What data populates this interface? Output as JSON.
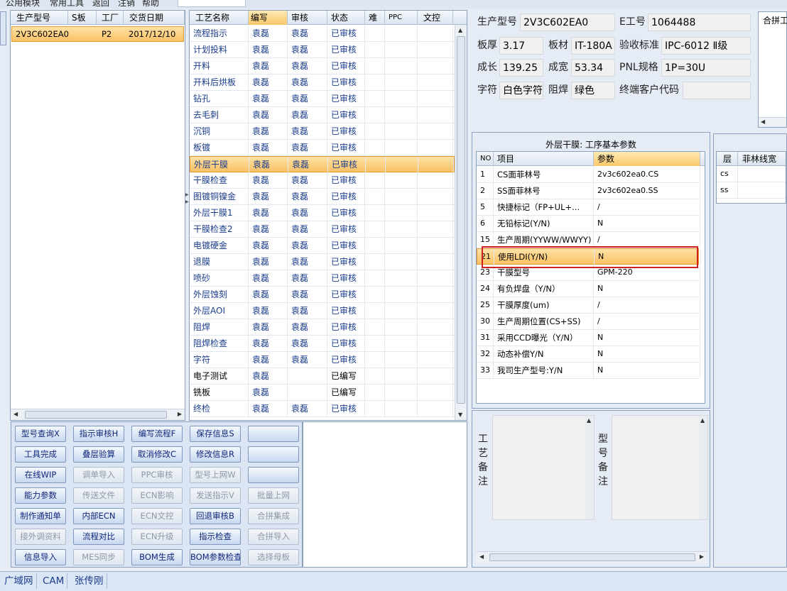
{
  "menu": [
    "公用模块",
    "常用工具",
    "返回",
    "注销",
    "帮助"
  ],
  "model_table": {
    "headers": [
      "生产型号",
      "S板",
      "工厂",
      "交货日期"
    ],
    "rows": [
      [
        "2V3C602EA0",
        "",
        "P2",
        "2017/12/10"
      ]
    ]
  },
  "process_table": {
    "headers": [
      "工艺名称",
      "编写",
      "审核",
      "状态",
      "难",
      "PPC",
      "文控"
    ],
    "rows": [
      [
        "流程指示",
        "袁磊",
        "袁磊",
        "已审核"
      ],
      [
        "计划投料",
        "袁磊",
        "袁磊",
        "已审核"
      ],
      [
        "开料",
        "袁磊",
        "袁磊",
        "已审核"
      ],
      [
        "开料后烘板",
        "袁磊",
        "袁磊",
        "已审核"
      ],
      [
        "钻孔",
        "袁磊",
        "袁磊",
        "已审核"
      ],
      [
        "去毛刺",
        "袁磊",
        "袁磊",
        "已审核"
      ],
      [
        "沉铜",
        "袁磊",
        "袁磊",
        "已审核"
      ],
      [
        "板镀",
        "袁磊",
        "袁磊",
        "已审核"
      ],
      [
        "外层干膜",
        "袁磊",
        "袁磊",
        "已审核"
      ],
      [
        "干膜检查",
        "袁磊",
        "袁磊",
        "已审核"
      ],
      [
        "图镀铜镍金",
        "袁磊",
        "袁磊",
        "已审核"
      ],
      [
        "外层干膜1",
        "袁磊",
        "袁磊",
        "已审核"
      ],
      [
        "干膜检查2",
        "袁磊",
        "袁磊",
        "已审核"
      ],
      [
        "电镀硬金",
        "袁磊",
        "袁磊",
        "已审核"
      ],
      [
        "退膜",
        "袁磊",
        "袁磊",
        "已审核"
      ],
      [
        "喷砂",
        "袁磊",
        "袁磊",
        "已审核"
      ],
      [
        "外层蚀刻",
        "袁磊",
        "袁磊",
        "已审核"
      ],
      [
        "外层AOI",
        "袁磊",
        "袁磊",
        "已审核"
      ],
      [
        "阻焊",
        "袁磊",
        "袁磊",
        "已审核"
      ],
      [
        "阻焊检查",
        "袁磊",
        "袁磊",
        "已审核"
      ],
      [
        "字符",
        "袁磊",
        "袁磊",
        "已审核"
      ],
      [
        "电子测试",
        "袁磊",
        "",
        "已编写"
      ],
      [
        "铣板",
        "袁磊",
        "",
        "已编写"
      ],
      [
        "终检",
        "袁磊",
        "袁磊",
        "已审核"
      ]
    ]
  },
  "buttons": [
    [
      {
        "label": "型号查询X",
        "enabled": true
      },
      {
        "label": "指示审核H",
        "enabled": true
      },
      {
        "label": "编写流程F",
        "enabled": true
      },
      {
        "label": "保存信息S",
        "enabled": true
      },
      {
        "label": "",
        "enabled": true
      }
    ],
    [
      {
        "label": "工具完成",
        "enabled": true
      },
      {
        "label": "叠层验算",
        "enabled": true
      },
      {
        "label": "取消修改C",
        "enabled": true
      },
      {
        "label": "修改信息R",
        "enabled": true
      },
      {
        "label": "",
        "enabled": true
      }
    ],
    [
      {
        "label": "在线WIP",
        "enabled": true
      },
      {
        "label": "调单导入",
        "enabled": false
      },
      {
        "label": "PPC审核",
        "enabled": false
      },
      {
        "label": "型号上网W",
        "enabled": false
      },
      {
        "label": "",
        "enabled": true
      }
    ],
    [
      {
        "label": "能力参数",
        "enabled": true
      },
      {
        "label": "传送文件",
        "enabled": false
      },
      {
        "label": "ECN影响",
        "enabled": false
      },
      {
        "label": "发送指示V",
        "enabled": false
      },
      {
        "label": "批量上网",
        "enabled": false
      }
    ],
    [
      {
        "label": "制作通知单",
        "enabled": true
      },
      {
        "label": "内部ECN",
        "enabled": true
      },
      {
        "label": "ECN文控",
        "enabled": false
      },
      {
        "label": "回退审核B",
        "enabled": true
      },
      {
        "label": "合拼集成",
        "enabled": false
      }
    ],
    [
      {
        "label": "接外调资料",
        "enabled": false
      },
      {
        "label": "流程对比",
        "enabled": true
      },
      {
        "label": "ECN升级",
        "enabled": false
      },
      {
        "label": "指示检查",
        "enabled": true
      },
      {
        "label": "合拼导入",
        "enabled": false
      }
    ],
    [
      {
        "label": "信息导入",
        "enabled": true
      },
      {
        "label": "MES同步",
        "enabled": false
      },
      {
        "label": "BOM生成",
        "enabled": true
      },
      {
        "label": "BOM参数检查",
        "enabled": true
      },
      {
        "label": "选择母板",
        "enabled": false
      }
    ]
  ],
  "info": {
    "model_label": "生产型号",
    "model_value": "2V3C602EA0",
    "eno_label": "E工号",
    "eno_value": "1064488",
    "thick_label": "板厚",
    "thick_value": "3.17",
    "material_label": "板材",
    "material_value": "IT-180A",
    "std_label": "验收标准",
    "std_value": "IPC-6012 Ⅱ级",
    "len_label": "成长",
    "len_value": "139.25",
    "width_label": "成宽",
    "width_value": "53.34",
    "pnl_label": "PNL规格",
    "pnl_value": "1P=30U",
    "char_label": "字符",
    "char_value": "白色字符",
    "mask_label": "阻焊",
    "mask_value": "绿色",
    "cust_label": "终端客户代码",
    "cust_value": ""
  },
  "combine_header": "合拼工",
  "params": {
    "title": "外层干膜: 工序基本参数",
    "headers": [
      "NO",
      "项目",
      "参数"
    ],
    "rows": [
      [
        "1",
        "CS面菲林号",
        "2v3c602ea0.CS"
      ],
      [
        "2",
        "SS面菲林号",
        "2v3c602ea0.SS"
      ],
      [
        "5",
        "快捷标记（FP+UL+...",
        "/"
      ],
      [
        "6",
        "无铅标记(Y/N)",
        "N"
      ],
      [
        "15",
        "生产周期(YYWW/WWYY)",
        "/"
      ],
      [
        "21",
        "使用LDI(Y/N)",
        "N"
      ],
      [
        "23",
        "干膜型号",
        "GPM-220"
      ],
      [
        "24",
        "有负焊盘（Y/N）",
        "N"
      ],
      [
        "25",
        "干膜厚度(um)",
        "/"
      ],
      [
        "30",
        "生产周期位置(CS+SS)",
        "/"
      ],
      [
        "31",
        "采用CCD曝光（Y/N）",
        "N"
      ],
      [
        "32",
        "动态补偿Y/N",
        "N"
      ],
      [
        "33",
        "我司生产型号:Y/N",
        "N"
      ]
    ]
  },
  "layers": {
    "headers": [
      "层",
      "菲林线宽"
    ],
    "rows": [
      [
        "cs",
        ""
      ],
      [
        "ss",
        ""
      ]
    ]
  },
  "notes": {
    "process_label": [
      "工",
      "艺",
      "备",
      "注"
    ],
    "model_label": [
      "型",
      "号",
      "备",
      "注"
    ]
  },
  "status_bar": [
    "广域网",
    "CAM",
    "张传刚"
  ],
  "colors": {
    "selection": "#f9c165",
    "highlight_box": "#d21f1f",
    "panel_bg": "#e6ecf5"
  }
}
